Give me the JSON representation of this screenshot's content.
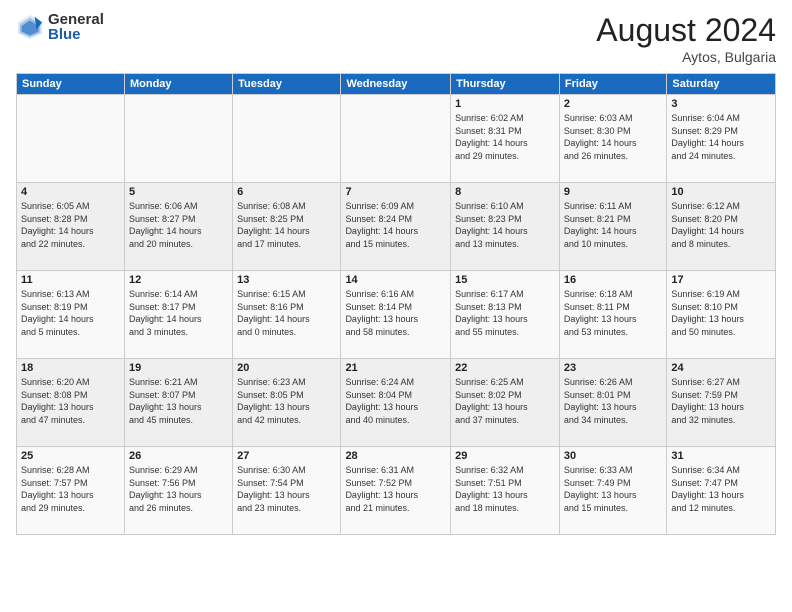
{
  "logo": {
    "general": "General",
    "blue": "Blue"
  },
  "title": "August 2024",
  "subtitle": "Aytos, Bulgaria",
  "weekdays": [
    "Sunday",
    "Monday",
    "Tuesday",
    "Wednesday",
    "Thursday",
    "Friday",
    "Saturday"
  ],
  "weeks": [
    [
      {
        "day": "",
        "info": ""
      },
      {
        "day": "",
        "info": ""
      },
      {
        "day": "",
        "info": ""
      },
      {
        "day": "",
        "info": ""
      },
      {
        "day": "1",
        "info": "Sunrise: 6:02 AM\nSunset: 8:31 PM\nDaylight: 14 hours\nand 29 minutes."
      },
      {
        "day": "2",
        "info": "Sunrise: 6:03 AM\nSunset: 8:30 PM\nDaylight: 14 hours\nand 26 minutes."
      },
      {
        "day": "3",
        "info": "Sunrise: 6:04 AM\nSunset: 8:29 PM\nDaylight: 14 hours\nand 24 minutes."
      }
    ],
    [
      {
        "day": "4",
        "info": "Sunrise: 6:05 AM\nSunset: 8:28 PM\nDaylight: 14 hours\nand 22 minutes."
      },
      {
        "day": "5",
        "info": "Sunrise: 6:06 AM\nSunset: 8:27 PM\nDaylight: 14 hours\nand 20 minutes."
      },
      {
        "day": "6",
        "info": "Sunrise: 6:08 AM\nSunset: 8:25 PM\nDaylight: 14 hours\nand 17 minutes."
      },
      {
        "day": "7",
        "info": "Sunrise: 6:09 AM\nSunset: 8:24 PM\nDaylight: 14 hours\nand 15 minutes."
      },
      {
        "day": "8",
        "info": "Sunrise: 6:10 AM\nSunset: 8:23 PM\nDaylight: 14 hours\nand 13 minutes."
      },
      {
        "day": "9",
        "info": "Sunrise: 6:11 AM\nSunset: 8:21 PM\nDaylight: 14 hours\nand 10 minutes."
      },
      {
        "day": "10",
        "info": "Sunrise: 6:12 AM\nSunset: 8:20 PM\nDaylight: 14 hours\nand 8 minutes."
      }
    ],
    [
      {
        "day": "11",
        "info": "Sunrise: 6:13 AM\nSunset: 8:19 PM\nDaylight: 14 hours\nand 5 minutes."
      },
      {
        "day": "12",
        "info": "Sunrise: 6:14 AM\nSunset: 8:17 PM\nDaylight: 14 hours\nand 3 minutes."
      },
      {
        "day": "13",
        "info": "Sunrise: 6:15 AM\nSunset: 8:16 PM\nDaylight: 14 hours\nand 0 minutes."
      },
      {
        "day": "14",
        "info": "Sunrise: 6:16 AM\nSunset: 8:14 PM\nDaylight: 13 hours\nand 58 minutes."
      },
      {
        "day": "15",
        "info": "Sunrise: 6:17 AM\nSunset: 8:13 PM\nDaylight: 13 hours\nand 55 minutes."
      },
      {
        "day": "16",
        "info": "Sunrise: 6:18 AM\nSunset: 8:11 PM\nDaylight: 13 hours\nand 53 minutes."
      },
      {
        "day": "17",
        "info": "Sunrise: 6:19 AM\nSunset: 8:10 PM\nDaylight: 13 hours\nand 50 minutes."
      }
    ],
    [
      {
        "day": "18",
        "info": "Sunrise: 6:20 AM\nSunset: 8:08 PM\nDaylight: 13 hours\nand 47 minutes."
      },
      {
        "day": "19",
        "info": "Sunrise: 6:21 AM\nSunset: 8:07 PM\nDaylight: 13 hours\nand 45 minutes."
      },
      {
        "day": "20",
        "info": "Sunrise: 6:23 AM\nSunset: 8:05 PM\nDaylight: 13 hours\nand 42 minutes."
      },
      {
        "day": "21",
        "info": "Sunrise: 6:24 AM\nSunset: 8:04 PM\nDaylight: 13 hours\nand 40 minutes."
      },
      {
        "day": "22",
        "info": "Sunrise: 6:25 AM\nSunset: 8:02 PM\nDaylight: 13 hours\nand 37 minutes."
      },
      {
        "day": "23",
        "info": "Sunrise: 6:26 AM\nSunset: 8:01 PM\nDaylight: 13 hours\nand 34 minutes."
      },
      {
        "day": "24",
        "info": "Sunrise: 6:27 AM\nSunset: 7:59 PM\nDaylight: 13 hours\nand 32 minutes."
      }
    ],
    [
      {
        "day": "25",
        "info": "Sunrise: 6:28 AM\nSunset: 7:57 PM\nDaylight: 13 hours\nand 29 minutes."
      },
      {
        "day": "26",
        "info": "Sunrise: 6:29 AM\nSunset: 7:56 PM\nDaylight: 13 hours\nand 26 minutes."
      },
      {
        "day": "27",
        "info": "Sunrise: 6:30 AM\nSunset: 7:54 PM\nDaylight: 13 hours\nand 23 minutes."
      },
      {
        "day": "28",
        "info": "Sunrise: 6:31 AM\nSunset: 7:52 PM\nDaylight: 13 hours\nand 21 minutes."
      },
      {
        "day": "29",
        "info": "Sunrise: 6:32 AM\nSunset: 7:51 PM\nDaylight: 13 hours\nand 18 minutes."
      },
      {
        "day": "30",
        "info": "Sunrise: 6:33 AM\nSunset: 7:49 PM\nDaylight: 13 hours\nand 15 minutes."
      },
      {
        "day": "31",
        "info": "Sunrise: 6:34 AM\nSunset: 7:47 PM\nDaylight: 13 hours\nand 12 minutes."
      }
    ]
  ]
}
